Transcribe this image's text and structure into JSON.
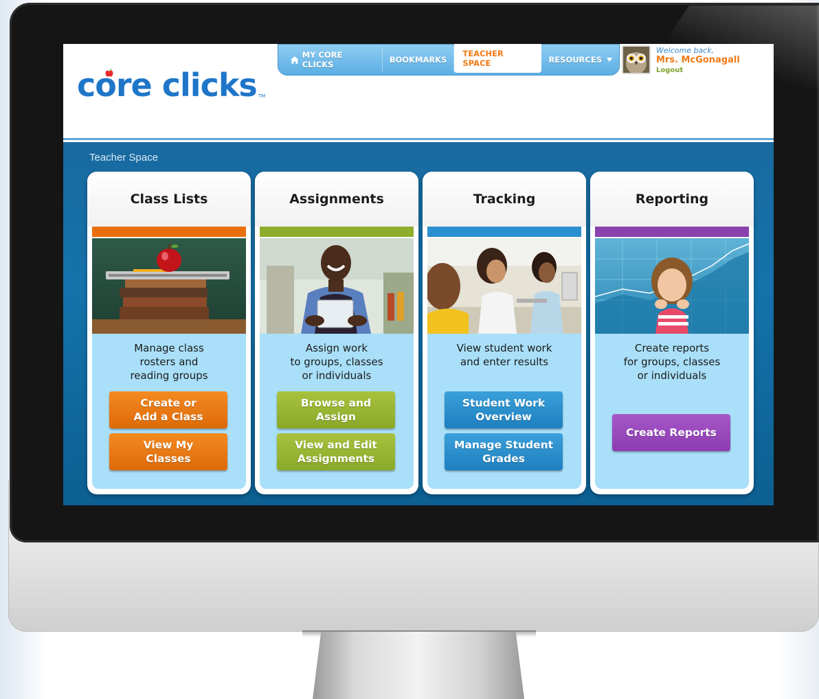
{
  "nav": {
    "items": [
      {
        "label": "MY CORE CLICKS",
        "icon": "home-icon"
      },
      {
        "label": "BOOKMARKS"
      },
      {
        "label": "TEACHER SPACE",
        "active": true
      },
      {
        "label": "RESOURCES",
        "icon": "caret-down-icon"
      }
    ]
  },
  "logo": {
    "text": "core clicks",
    "tm": "TM"
  },
  "user": {
    "welcome": "Welcome back,",
    "name": "Mrs. McGonagall",
    "logout": "Logout"
  },
  "page": {
    "breadcrumb": "Teacher Space"
  },
  "cards": [
    {
      "title": "Class Lists",
      "accent": "#e96f0e",
      "desc": "Manage class\nrosters and\nreading groups",
      "buttons": [
        "Create or\nAdd a Class",
        "View My\nClasses"
      ]
    },
    {
      "title": "Assignments",
      "accent": "#8fad2c",
      "desc": "Assign work\nto groups, classes\nor individuals",
      "buttons": [
        "Browse and\nAssign",
        "View and Edit\nAssignments"
      ]
    },
    {
      "title": "Tracking",
      "accent": "#2c8fcf",
      "desc": "View student work\nand enter results",
      "buttons": [
        "Student Work\nOverview",
        "Manage Student\nGrades"
      ]
    },
    {
      "title": "Reporting",
      "accent": "#8a41ad",
      "desc": "Create reports\nfor groups, classes\nor individuals",
      "buttons": [
        "Create Reports"
      ]
    }
  ]
}
